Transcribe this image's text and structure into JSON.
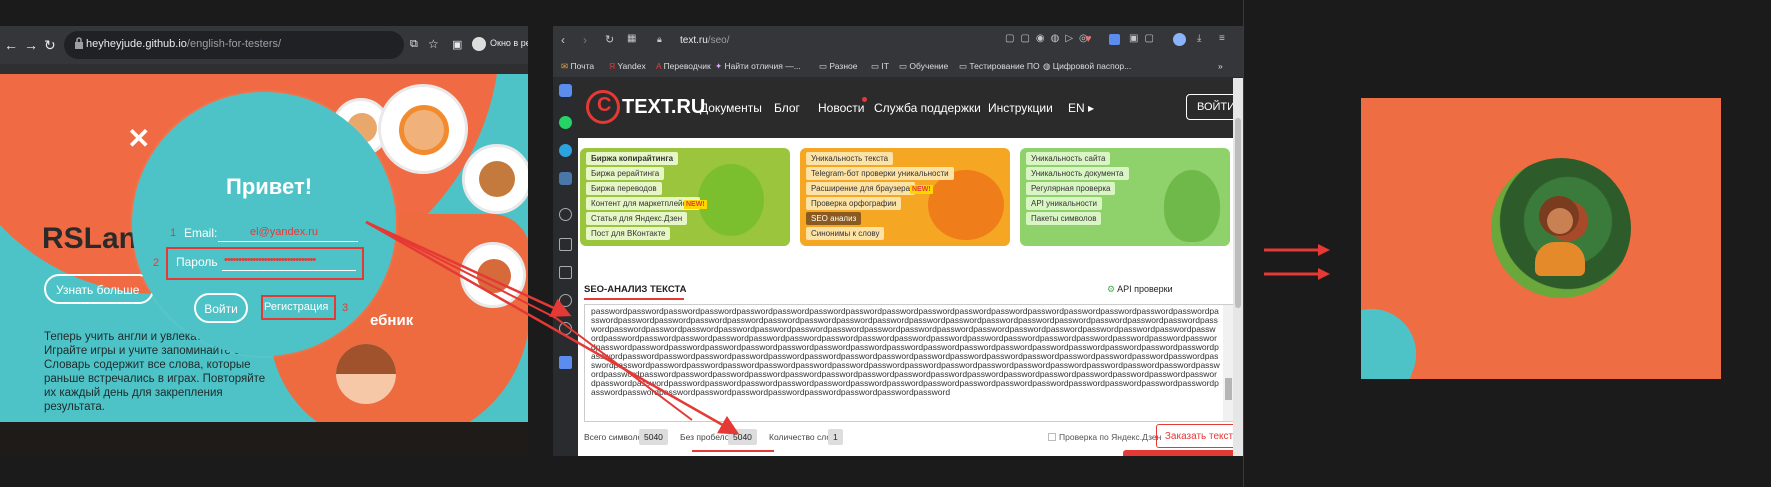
{
  "left_browser": {
    "url_host": "heyheyjude.github.io",
    "url_path": "/english-for-testers/",
    "window_label": "Окно в ре",
    "page": {
      "title": "RSLan",
      "learn_more": "Узнать больше",
      "paragraph": "Теперь учить англи и увлекательно! Играйте игры и учите запоминайте сл Словарь содержит все слова, которые раньше встречались в играх. Повторяйте их каждый день для закрепления результата.",
      "dictionary_label": "ебник"
    },
    "modal": {
      "heading": "Привет!",
      "email_label": "Email:",
      "email_value": "el@yandex.ru",
      "password_label": "Пароль",
      "password_value": "••••••••••••••••••••••••••••••••",
      "login_button": "Войти",
      "register_button": "Регистрация",
      "markers": [
        "1",
        "2",
        "3"
      ]
    }
  },
  "middle_browser": {
    "url_host": "text.ru",
    "url_path": "/seo/",
    "bookmarks": [
      "Почта",
      "Yandex",
      "Переводчик",
      "Найти отличия —...",
      "Разное",
      "IT",
      "Обучение",
      "Тестирование ПО",
      "Цифровой паспор..."
    ],
    "site": {
      "logo": "TEXT.RU",
      "nav": [
        "Документы",
        "Блог",
        "Новости",
        "Служба поддержки",
        "Инструкции",
        "EN"
      ],
      "login": "ВОЙТИ",
      "banner_green": [
        "Биржа копирайтинга",
        "Биржа рерайтинга",
        "Биржа переводов",
        "Контент для маркетплейсов",
        "Статья для Яндекс.Дзен",
        "Пост для ВКонтакте"
      ],
      "banner_orange": [
        "Уникальность текста",
        "Telegram-бот проверки уникальности",
        "Расширение для браузера",
        "Проверка орфографии",
        "SEO анализ",
        "Синонимы к слову"
      ],
      "banner_lime": [
        "Уникальность сайта",
        "Уникальность документа",
        "Регулярная проверка",
        "API уникальности",
        "Пакеты символов"
      ],
      "new_badge": "NEW!",
      "seo_title": "SEO-АНАЛИЗ ТЕКСТА",
      "api_check": "API проверки",
      "textarea_text": "passwordpasswordpasswordpasswordpasswordpasswordpasswordpasswordpasswordpasswordpasswordpasswordpasswordpasswordpasswordpasswordpasswordpasswordpasswordpasswordpasswordpasswordpasswordpasswordpasswordpasswordpasswordpasswordpasswordpasswordpasswordpasswordpasswordpasswordpasswordpasswordpasswordpasswordpasswordpasswordpasswordpasswordpasswordpasswordpasswordpasswordpasswordpasswordpasswordpasswordpasswordpasswordpasswordpasswordpasswordpasswordpasswordpasswordpasswordpasswordpasswordpasswordpasswordpasswordpasswordpasswordpasswordpasswordpasswordpasswordpasswordpasswordpasswordpasswordpasswordpasswordpasswordpasswordpasswordpasswordpasswordpasswordpasswordpasswordpasswordpasswordpasswordpasswordpasswordpasswordpasswordpasswordpasswordpasswordpasswordpasswordpasswordpasswordpasswordpasswordpasswordpasswordpasswordpasswordpasswordpasswordpasswordpasswordpasswordpasswordpasswordpasswordpasswordpasswordpasswordpasswordpasswordpasswordpasswordpasswordpasswordpasswordpasswordpasswordpasswordpasswordpasswordpasswordpasswordpasswordpasswordpasswordpasswordpasswordpasswordpasswordpasswordpasswordpasswordpasswordpasswordpasswordpasswordpasswordpasswordpasswordpasswordpasswordpasswordpasswordpasswordpasswordpasswordpasswordpasswordpasswordpasswordpasswordpasswordpasswordpasswordpasswordpasswordpasswordpassword",
      "stats": {
        "total_label": "Всего символов:",
        "total_value": "5040",
        "no_spaces_label": "Без пробелов:",
        "no_spaces_value": "5040",
        "words_label": "Количество слов:",
        "words_value": "1"
      },
      "yandex_check": "Проверка по Яндекс.Дзен",
      "order_button": "Заказать текст"
    }
  },
  "colors": {
    "accent_red": "#e53935",
    "teal": "#4ec3c7",
    "orange": "#ef6d43"
  }
}
